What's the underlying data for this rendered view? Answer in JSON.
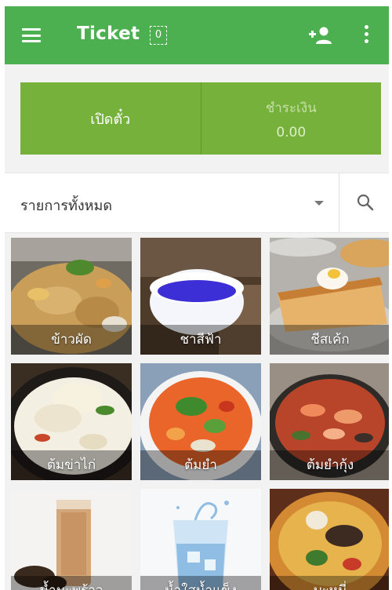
{
  "appbar": {
    "title": "Ticket",
    "badge_count": "0",
    "icons": [
      "menu-icon",
      "add-person-icon",
      "more-vert-icon"
    ],
    "color": "#4caf50"
  },
  "actions": {
    "open_ticket_label": "เปิดตั๋ว",
    "pay_label": "ชำระเงิน",
    "pay_amount": "0.00",
    "color": "#76b13b"
  },
  "filter": {
    "category_label": "รายการทั้งหมด",
    "icons": [
      "dropdown-caret-icon",
      "search-icon"
    ]
  },
  "items": [
    {
      "name": "ข้าวผัด"
    },
    {
      "name": "ชาสีฟ้า"
    },
    {
      "name": "ชีสเค้ก"
    },
    {
      "name": "ต้มข่าไก่"
    },
    {
      "name": "ต้มยำ"
    },
    {
      "name": "ต้มยำกุ้ง"
    },
    {
      "name": "น้ำมะพร้าว"
    },
    {
      "name": "น้ำใสน้ำแข็ง"
    },
    {
      "name": "บะหมี่"
    }
  ]
}
